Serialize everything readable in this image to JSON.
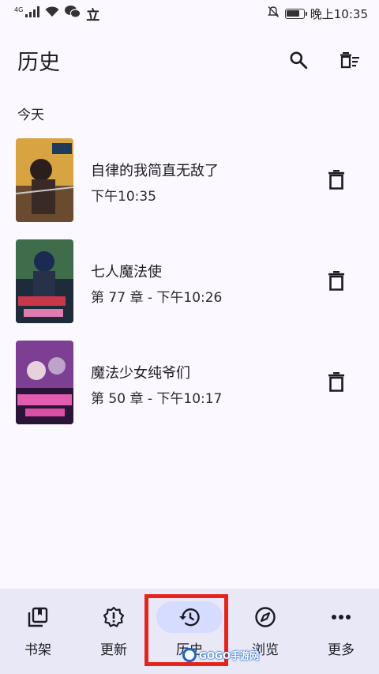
{
  "status_bar": {
    "network": "4G",
    "app_char": "立",
    "time": "晚上10:35",
    "battery_level": 0.8
  },
  "app_bar": {
    "title": "历史",
    "search_icon": "search-icon",
    "clear_icon": "clear-all-icon"
  },
  "section_header": "今天",
  "history": [
    {
      "title": "自律的我简直无敌了",
      "meta": "下午10:35",
      "cover_colors": [
        "#d7a441",
        "#3a2a25"
      ]
    },
    {
      "title": "七人魔法使",
      "meta": "第 77 章 - 下午10:26",
      "cover_colors": [
        "#3f6c4a",
        "#1e2b3a"
      ]
    },
    {
      "title": "魔法少女纯爷们",
      "meta": "第 50 章 - 下午10:17",
      "cover_colors": [
        "#7c3f93",
        "#2a1538"
      ]
    }
  ],
  "bottom_nav": [
    {
      "label": "书架",
      "icon": "library-icon",
      "active": false
    },
    {
      "label": "更新",
      "icon": "updates-icon",
      "active": false
    },
    {
      "label": "历史",
      "icon": "history-icon",
      "active": true
    },
    {
      "label": "浏览",
      "icon": "compass-icon",
      "active": false
    },
    {
      "label": "更多",
      "icon": "more-icon",
      "active": false
    }
  ],
  "watermark": "GOGO手游网",
  "colors": {
    "background": "#fbf8ff",
    "nav_background": "#e9e8f7",
    "active_pill": "#d6dcff",
    "highlight": "#e3251b"
  }
}
